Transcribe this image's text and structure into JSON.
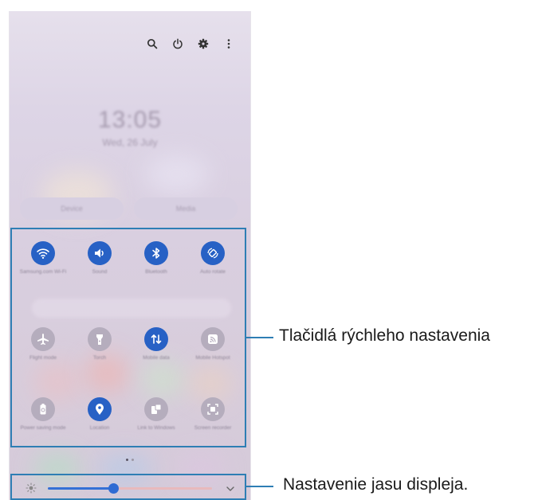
{
  "clock": {
    "time": "13:05",
    "date": "Wed, 26 July"
  },
  "media_buttons": [
    "Device",
    "Media"
  ],
  "quick_settings": {
    "tiles": [
      {
        "label": "Samsung.com Wi-Fi",
        "icon": "wifi-icon",
        "state": "on"
      },
      {
        "label": "Sound",
        "icon": "speaker-icon",
        "state": "on"
      },
      {
        "label": "Bluetooth",
        "icon": "bluetooth-icon",
        "state": "on"
      },
      {
        "label": "Auto rotate",
        "icon": "auto-rotate-icon",
        "state": "on"
      },
      {
        "label": "Flight mode",
        "icon": "airplane-icon",
        "state": "off"
      },
      {
        "label": "Torch",
        "icon": "flashlight-icon",
        "state": "off"
      },
      {
        "label": "Mobile data",
        "icon": "mobile-data-icon",
        "state": "on"
      },
      {
        "label": "Mobile Hotspot",
        "icon": "hotspot-icon",
        "state": "off"
      },
      {
        "label": "Power saving mode",
        "icon": "power-saving-icon",
        "state": "off"
      },
      {
        "label": "Location",
        "icon": "location-icon",
        "state": "on"
      },
      {
        "label": "Link to Windows",
        "icon": "link-windows-icon",
        "state": "off"
      },
      {
        "label": "Screen recorder",
        "icon": "screen-recorder-icon",
        "state": "off"
      }
    ]
  },
  "brightness": {
    "level": 0.4
  },
  "callouts": {
    "quick_settings": "Tlačidlá rýchleho nastavenia",
    "brightness": "Nastavenie jasu displeja."
  },
  "colors": {
    "accent": "#2761c5",
    "highlight": "#2e7eb4"
  }
}
